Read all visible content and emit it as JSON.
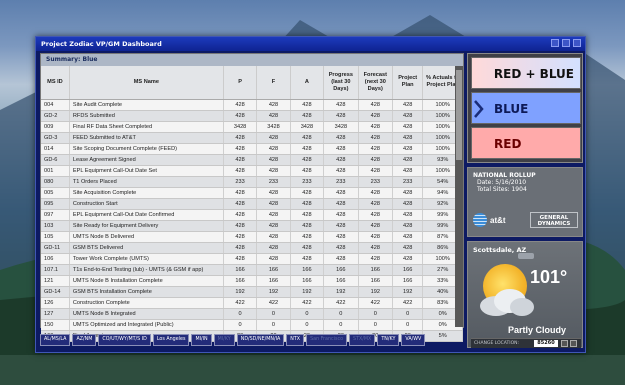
{
  "window": {
    "title": "Project Zodiac VP/GM Dashboard"
  },
  "summary": {
    "label": "Summary: Blue"
  },
  "table": {
    "headers": [
      "MS ID",
      "MS Name",
      "P",
      "F",
      "A",
      "Progress (last 30 Days)",
      "Forecast (next 30 Days)",
      "Project Plan",
      "% Actuals to Project Plan"
    ],
    "rows": [
      [
        "004",
        "Site Audit Complete",
        "428",
        "428",
        "428",
        "428",
        "428",
        "428",
        "100%"
      ],
      [
        "GD-2",
        "RFDS Submitted",
        "428",
        "428",
        "428",
        "428",
        "428",
        "428",
        "100%"
      ],
      [
        "009",
        "Final RF Data Sheet Completed",
        "3428",
        "3428",
        "3428",
        "3428",
        "428",
        "428",
        "100%"
      ],
      [
        "GD-3",
        "FEED Submitted to AT&T",
        "428",
        "428",
        "428",
        "428",
        "428",
        "428",
        "100%"
      ],
      [
        "014",
        "Site Scoping Document Complete (FEED)",
        "428",
        "428",
        "428",
        "428",
        "428",
        "428",
        "100%"
      ],
      [
        "GD-6",
        "Lease Agreement Signed",
        "428",
        "428",
        "428",
        "428",
        "428",
        "428",
        "93%"
      ],
      [
        "001",
        "EPL Equipment Call-Out Date Set",
        "428",
        "428",
        "428",
        "428",
        "428",
        "428",
        "100%"
      ],
      [
        "080",
        "T1 Orders Placed",
        "233",
        "233",
        "233",
        "233",
        "233",
        "233",
        "54%"
      ],
      [
        "005",
        "Site Acquisition Complete",
        "428",
        "428",
        "428",
        "428",
        "428",
        "428",
        "94%"
      ],
      [
        "095",
        "Construction Start",
        "428",
        "428",
        "428",
        "428",
        "428",
        "428",
        "92%"
      ],
      [
        "097",
        "EPL Equipment Call-Out Date Confirmed",
        "428",
        "428",
        "428",
        "428",
        "428",
        "428",
        "99%"
      ],
      [
        "103",
        "Site Ready for Equipment Delivery",
        "428",
        "428",
        "428",
        "428",
        "428",
        "428",
        "99%"
      ],
      [
        "105",
        "UMTS Node B Delivered",
        "428",
        "428",
        "428",
        "428",
        "428",
        "428",
        "87%"
      ],
      [
        "GD-11",
        "GSM BTS Delivered",
        "428",
        "428",
        "428",
        "428",
        "428",
        "428",
        "86%"
      ],
      [
        "106",
        "Tower Work Complete (UMTS)",
        "428",
        "428",
        "428",
        "428",
        "428",
        "428",
        "100%"
      ],
      [
        "107.1",
        "T1s End-to-End Testing (lub) - UMTS (& GSM if app)",
        "166",
        "166",
        "166",
        "166",
        "166",
        "166",
        "27%"
      ],
      [
        "121",
        "UMTS Node B Installation Complete",
        "166",
        "166",
        "166",
        "166",
        "166",
        "166",
        "33%"
      ],
      [
        "GD-14",
        "GSM BTS Installation Complete",
        "192",
        "192",
        "192",
        "192",
        "192",
        "192",
        "40%"
      ],
      [
        "126",
        "Construction Complete",
        "422",
        "422",
        "422",
        "422",
        "422",
        "422",
        "83%"
      ],
      [
        "127",
        "UMTS Node B Integrated",
        "0",
        "0",
        "0",
        "0",
        "0",
        "0",
        "0%"
      ],
      [
        "150",
        "UMTS Optimized and Integrated (Public)",
        "0",
        "0",
        "0",
        "0",
        "0",
        "0",
        "0%"
      ],
      [
        "160",
        "Final Acceptance",
        "20",
        "20",
        "20",
        "20",
        "20",
        "20",
        "5%"
      ]
    ]
  },
  "tabs": [
    {
      "label": "AL/MS/LA",
      "enabled": true
    },
    {
      "label": "AZ/NM",
      "enabled": true
    },
    {
      "label": "CO/UT/WY/MT/S ID",
      "enabled": true
    },
    {
      "label": "Los Angeles",
      "enabled": true
    },
    {
      "label": "MI/IN",
      "enabled": true
    },
    {
      "label": "MI/KY",
      "enabled": false
    },
    {
      "label": "ND/SD/NE/MN/IA",
      "enabled": true
    },
    {
      "label": "NTX",
      "enabled": true
    },
    {
      "label": "San Francisco",
      "enabled": false
    },
    {
      "label": "STX/MX",
      "enabled": false
    },
    {
      "label": "TN/KY",
      "enabled": true
    },
    {
      "label": "VA/WV",
      "enabled": true
    }
  ],
  "view_selector": {
    "options": [
      "RED + BLUE",
      "BLUE",
      "RED"
    ],
    "selected": "BLUE"
  },
  "rollup": {
    "title": "NATIONAL ROLLUP",
    "date_line": "Date: 5/16/2010",
    "sites_line": "Total Sites: 1904",
    "logo_att": "at&t",
    "logo_gd_line1": "GENERAL",
    "logo_gd_line2": "DYNAMICS"
  },
  "weather": {
    "location": "Scottsdale, AZ",
    "temperature": "101°",
    "condition": "Partly Cloudy",
    "change_label": "CHANGE LOCATION:",
    "zip": "85260"
  },
  "colors": {
    "red": "#ffaaaa",
    "blue": "#7fa1ff",
    "window": "#0d1a63"
  }
}
